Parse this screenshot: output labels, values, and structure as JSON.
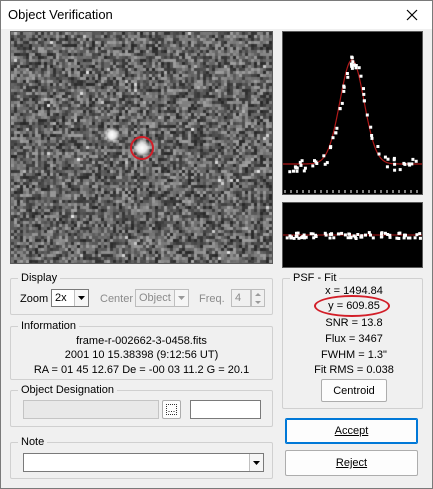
{
  "window": {
    "title": "Object Verification"
  },
  "display": {
    "group_label": "Display",
    "zoom_label": "Zoom",
    "zoom_value": "2x",
    "center_label": "Center",
    "center_value": "Object",
    "freq_label": "Freq.",
    "freq_value": "4"
  },
  "information": {
    "group_label": "Information",
    "filename": "frame-r-002662-3-0458.fits",
    "date": "2001 10 15.38398 (9:12:56 UT)",
    "coords": "RA = 01 45 12.67   De = -00 03 11.2   G = 20.1"
  },
  "designation": {
    "group_label": "Object Designation",
    "browse_label": "...",
    "value": "",
    "secondary_value": ""
  },
  "note": {
    "group_label": "Note",
    "value": ""
  },
  "psf": {
    "group_label": "PSF - Fit",
    "x": "x = 1494.84",
    "y": "y = 609.85",
    "snr": "SNR = 13.8",
    "flux": "Flux = 3467",
    "fwhm": "FWHM = 1.3\"",
    "rms": "Fit RMS = 0.038",
    "centroid_label": "Centroid"
  },
  "buttons": {
    "accept": "Accept",
    "reject": "Reject"
  },
  "colors": {
    "highlight": "#d21e28",
    "fit_curve": "#b01818",
    "accent": "#0078d7"
  }
}
